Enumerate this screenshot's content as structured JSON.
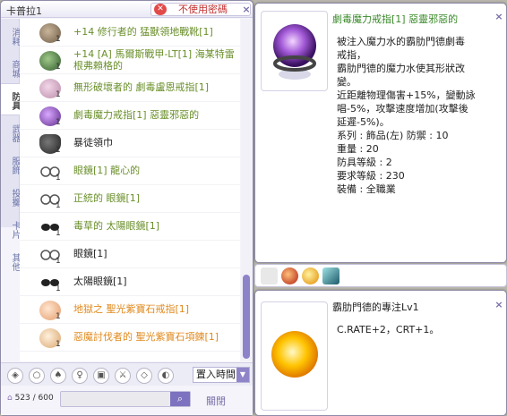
{
  "inventory": {
    "title": "卡普拉1",
    "password_button": "不使用密碼",
    "close_x": "×",
    "tabs": [
      "消耗",
      "商城",
      "防具",
      "武器",
      "服飾",
      "投擲",
      "卡片",
      "其他"
    ],
    "active_tab": "防具",
    "items": [
      {
        "label": "+14 修行者的 猛獸領地戰靴[1]",
        "color": "green",
        "qty": "1",
        "icon": "boots-icon"
      },
      {
        "label": "+14 [A] 馬爾斯戰甲-LT[1] 海某特雷根弗賴格的",
        "color": "green",
        "qty": "1",
        "icon": "armor-icon"
      },
      {
        "label": "無形破壞者的 劇毒盧恩戒指[1]",
        "color": "green",
        "qty": "1",
        "icon": "ring-icon"
      },
      {
        "label": "劇毒魔力戒指[1] 惡靈邪惡的",
        "color": "green",
        "qty": "1",
        "icon": "magic-ring-icon"
      },
      {
        "label": "暴徒領巾",
        "color": "black",
        "qty": "1",
        "icon": "scarf-icon"
      },
      {
        "label": "眼鏡[1] 龍心的",
        "color": "green",
        "qty": "1",
        "icon": "glasses-icon"
      },
      {
        "label": "正統的 眼鏡[1]",
        "color": "green",
        "qty": "1",
        "icon": "glasses-icon"
      },
      {
        "label": "毒草的 太陽眼鏡[1]",
        "color": "green",
        "qty": "1",
        "icon": "sunglasses-icon"
      },
      {
        "label": "眼鏡[1]",
        "color": "black",
        "qty": "1",
        "icon": "glasses-icon"
      },
      {
        "label": "太陽眼鏡[1]",
        "color": "black",
        "qty": "1",
        "icon": "sunglasses-icon"
      },
      {
        "label": "地獄之 聖光紫寶石戒指[1]",
        "color": "orange",
        "qty": "1",
        "icon": "gem-ring-icon"
      },
      {
        "label": "惡魔討伐者的 聖光紫寶石項鍊[1]",
        "color": "orange",
        "qty": "1",
        "icon": "necklace-icon"
      }
    ],
    "filter_icons": [
      "shield-filter-icon",
      "ring-filter-icon",
      "helm-filter-icon",
      "accessory-filter-icon",
      "armor-filter-icon",
      "weapon-filter-icon",
      "garment-filter-icon",
      "shoes-filter-icon"
    ],
    "sort_label": "置入時間",
    "count": "523 / 600",
    "close_label": "關閉"
  },
  "item_info": {
    "name": "劇毒魔力戒指[1] 惡靈邪惡的",
    "description": [
      "被注入魔力水的霸肋門德劇毒",
      "戒指，",
      "霸肋門德的魔力水使其形狀改",
      "變。",
      "近距離物理傷害+15%，變動詠",
      "唱-5%，攻擊速度增加(攻擊後",
      "延遲-5%)。",
      "系列 : 飾品(左) 防禦 : 10",
      "重量 : 20",
      "防具等級 : 2",
      "要求等級 : 230",
      "裝備 : 全職業"
    ]
  },
  "card_slots": [
    "gear-card-icon",
    "red-orb-card-icon",
    "yellow-orb-card-icon",
    "crystal-card-icon"
  ],
  "skill_info": {
    "name": "霸肋門德的專注Lv1",
    "description": "C.RATE+2，CRT+1。"
  },
  "colors": {
    "green": "#6a8f2a",
    "orange": "#e08a1e",
    "black": "#222222",
    "accent": "#8d83c9"
  }
}
